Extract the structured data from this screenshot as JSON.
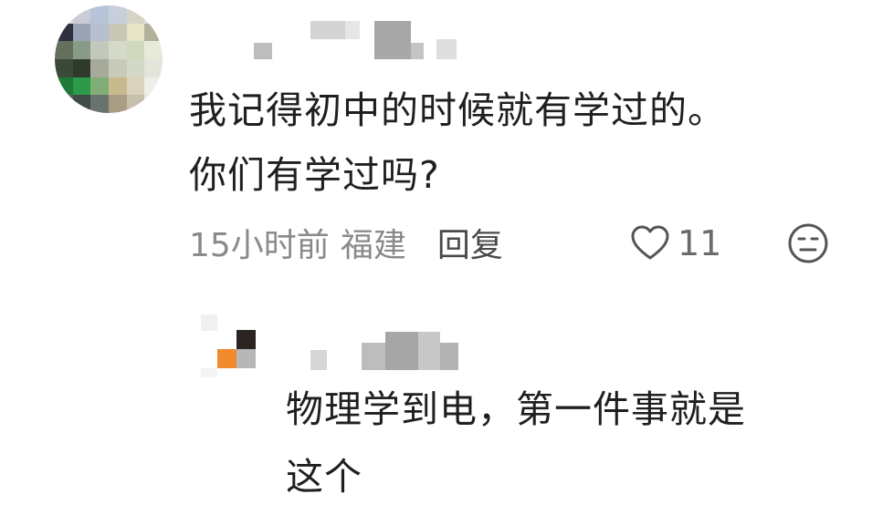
{
  "comment": {
    "text_line1": "我记得初中的时候就有学过的。",
    "text_line2": "你们有学过吗?",
    "time": "15小时前",
    "location": "福建",
    "reply_label": "回复",
    "like_count": "11",
    "like_icon": "heart-outline-icon",
    "emoji_icon": "neutral-face-icon"
  },
  "reply": {
    "text_line1": "物理学到电，第一件事就是",
    "text_line2": "这个"
  }
}
